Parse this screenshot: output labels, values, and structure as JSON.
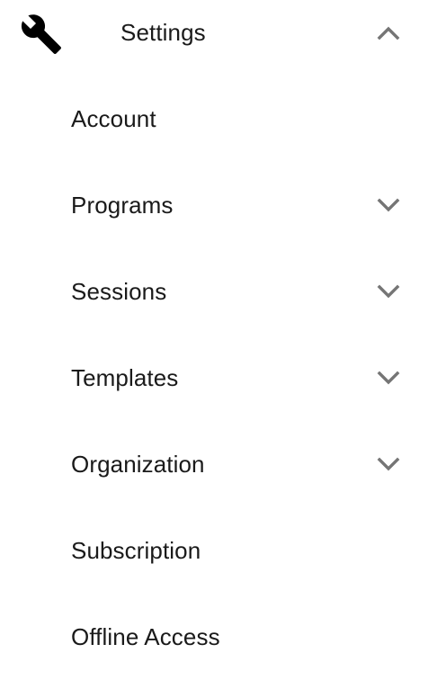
{
  "header": {
    "icon": "wrench-icon",
    "title": "Settings",
    "toggle_icon": "chevron-up-icon"
  },
  "items": [
    {
      "label": "Account",
      "expandable": false
    },
    {
      "label": "Programs",
      "expandable": true,
      "icon": "chevron-down-icon"
    },
    {
      "label": "Sessions",
      "expandable": true,
      "icon": "chevron-down-icon"
    },
    {
      "label": "Templates",
      "expandable": true,
      "icon": "chevron-down-icon"
    },
    {
      "label": "Organization",
      "expandable": true,
      "icon": "chevron-down-icon"
    },
    {
      "label": "Subscription",
      "expandable": false
    },
    {
      "label": "Offline Access",
      "expandable": false
    }
  ],
  "colors": {
    "text": "#1a1a1a",
    "icon": "#000000",
    "chevron": "#757575",
    "background": "#ffffff"
  }
}
